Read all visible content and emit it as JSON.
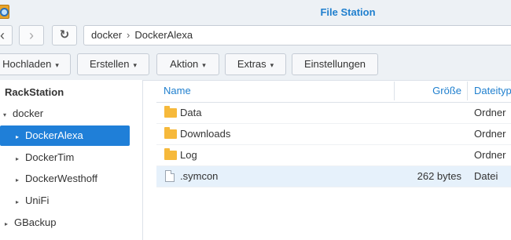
{
  "window": {
    "title": "File Station",
    "app_icon": "file-station-icon"
  },
  "nav": {
    "back_icon": "chevron-left-icon",
    "forward_icon": "chevron-right-icon",
    "refresh_icon": "refresh-icon",
    "back_glyph": "‹",
    "forward_glyph": "›",
    "refresh_glyph": "↻",
    "path": [
      "docker",
      "DockerAlexa"
    ],
    "path_separator": "›"
  },
  "toolbar": {
    "upload": "Hochladen",
    "create": "Erstellen",
    "action": "Aktion",
    "extras": "Extras",
    "settings": "Einstellungen",
    "caret": "▾"
  },
  "sidebar": {
    "root": "RackStation",
    "items": [
      {
        "label": "docker",
        "level": 1,
        "expanded": true,
        "selected": false
      },
      {
        "label": "DockerAlexa",
        "level": 2,
        "expanded": false,
        "selected": true
      },
      {
        "label": "DockerTim",
        "level": 2,
        "expanded": false,
        "selected": false
      },
      {
        "label": "DockerWesthoff",
        "level": 2,
        "expanded": false,
        "selected": false
      },
      {
        "label": "UniFi",
        "level": 2,
        "expanded": false,
        "selected": false
      },
      {
        "label": "GBackup",
        "level": 1,
        "expanded": false,
        "selected": false
      }
    ],
    "glyph_expanded": "▾",
    "glyph_collapsed": "▸"
  },
  "table": {
    "columns": {
      "name": "Name",
      "size": "Größe",
      "type": "Dateityp"
    },
    "rows": [
      {
        "name": "Data",
        "size": "",
        "type": "Ordner",
        "icon": "folder-icon"
      },
      {
        "name": "Downloads",
        "size": "",
        "type": "Ordner",
        "icon": "folder-icon"
      },
      {
        "name": "Log",
        "size": "",
        "type": "Ordner",
        "icon": "folder-icon"
      },
      {
        "name": ".symcon",
        "size": "262 bytes",
        "type": "Datei",
        "icon": "file-icon",
        "selected": true
      }
    ]
  },
  "colors": {
    "accent": "#1f7fce",
    "selected_bg": "#1f7fd8",
    "row_selected_bg": "#e6f1fb",
    "folder": "#f6b93b"
  }
}
